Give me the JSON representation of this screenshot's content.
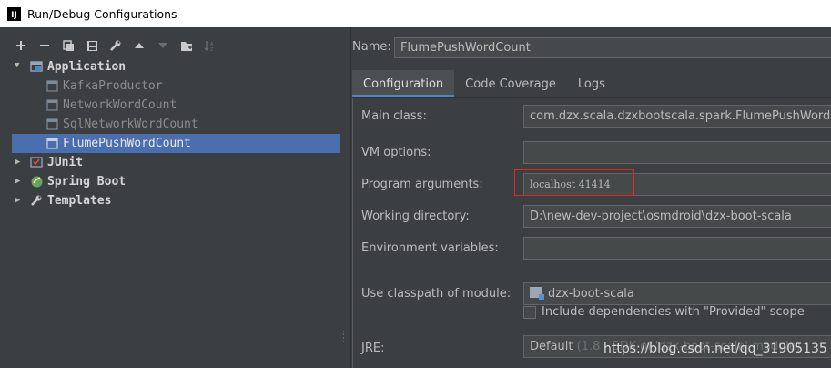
{
  "window": {
    "title": "Run/Debug Configurations",
    "logo": "IJ"
  },
  "toolbar": {
    "icons": [
      "add-icon",
      "remove-icon",
      "copy-icon",
      "save-icon",
      "wrench-icon",
      "move-up-icon",
      "move-down-icon",
      "folder-icon",
      "sort-icon"
    ]
  },
  "tree": {
    "application": {
      "label": "Application",
      "icon": "application-icon"
    },
    "children": [
      {
        "label": "KafkaProductor"
      },
      {
        "label": "NetworkWordCount"
      },
      {
        "label": "SqlNetworkWordCount"
      },
      {
        "label": "FlumePushWordCount",
        "selected": true
      }
    ],
    "groups": [
      {
        "label": "JUnit",
        "icon": "junit-icon"
      },
      {
        "label": "Spring Boot",
        "icon": "spring-boot-icon"
      },
      {
        "label": "Templates",
        "icon": "wrench-icon"
      }
    ]
  },
  "config": {
    "name_label": "Name:",
    "name_value": "FlumePushWordCount",
    "tabs": [
      "Configuration",
      "Code Coverage",
      "Logs"
    ],
    "active_tab": "Configuration",
    "fields": {
      "main_class_label": "Main class:",
      "main_class_value": "com.dzx.scala.dzxbootscala.spark.FlumePushWordCo",
      "vm_options_label": "VM options:",
      "vm_options_value": "",
      "program_args_label": "Program arguments:",
      "program_args_value": "localhost 41414",
      "working_dir_label": "Working directory:",
      "working_dir_value": "D:\\new-dev-project\\osmdroid\\dzx-boot-scala",
      "env_vars_label": "Environment variables:",
      "env_vars_value": "",
      "classpath_label": "Use classpath of module:",
      "classpath_value": "dzx-boot-scala",
      "include_deps_label": "Include dependencies with \"Provided\" scope",
      "include_deps_checked": false,
      "jre_label": "JRE:",
      "jre_value": "Default",
      "jre_hint": "(1.8 - SDK of 'dzx-boot-scala' module)"
    }
  },
  "watermark": "https://blog.csdn.net/qq_31905135",
  "colors": {
    "background": "#3c3f41",
    "selection": "#4b6eaf",
    "highlight_box": "#e0282a",
    "tab_underline": "#4a88c7"
  }
}
